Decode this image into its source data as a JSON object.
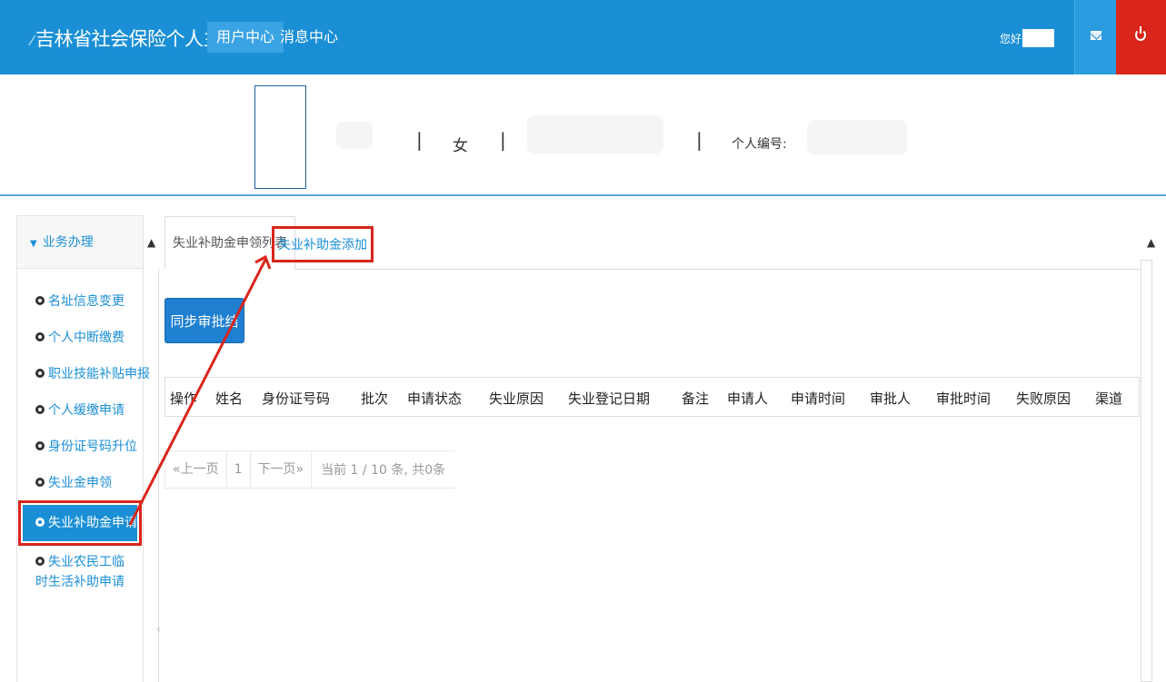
{
  "header": {
    "logo": "吉林省社会保险个人主页",
    "nav": [
      "用户中心",
      "消息中心"
    ],
    "greeting": "您好,"
  },
  "profile": {
    "gender": "女",
    "separator": "|",
    "person_id_label": "个人编号:"
  },
  "sidebar": {
    "title": "业务办理",
    "items": [
      {
        "label": "名址信息变更"
      },
      {
        "label": "个人中断缴费"
      },
      {
        "label": "职业技能补贴申报"
      },
      {
        "label": "个人缓缴申请"
      },
      {
        "label": "身份证号码升位"
      },
      {
        "label": "失业金申领"
      },
      {
        "label": "失业补助金申请"
      },
      {
        "label": "失业农民工临时生活补助申请"
      }
    ]
  },
  "tabs": {
    "list": "失业补助金申领列表",
    "add": "失业补助金添加"
  },
  "actions": {
    "sync": "同步审批结果"
  },
  "table": {
    "columns": [
      "操作",
      "姓名",
      "身份证号码",
      "批次",
      "申请状态",
      "失业原因",
      "失业登记日期",
      "备注",
      "申请人",
      "申请时间",
      "审批人",
      "审批时间",
      "失败原因",
      "渠道"
    ],
    "rows": []
  },
  "pager": {
    "prev": "«上一页",
    "page": "1",
    "next": "下一页»",
    "info": "当前 1 / 10 条, 共0条"
  },
  "colors": {
    "primary": "#1a8fd6",
    "danger": "#d9251c"
  }
}
